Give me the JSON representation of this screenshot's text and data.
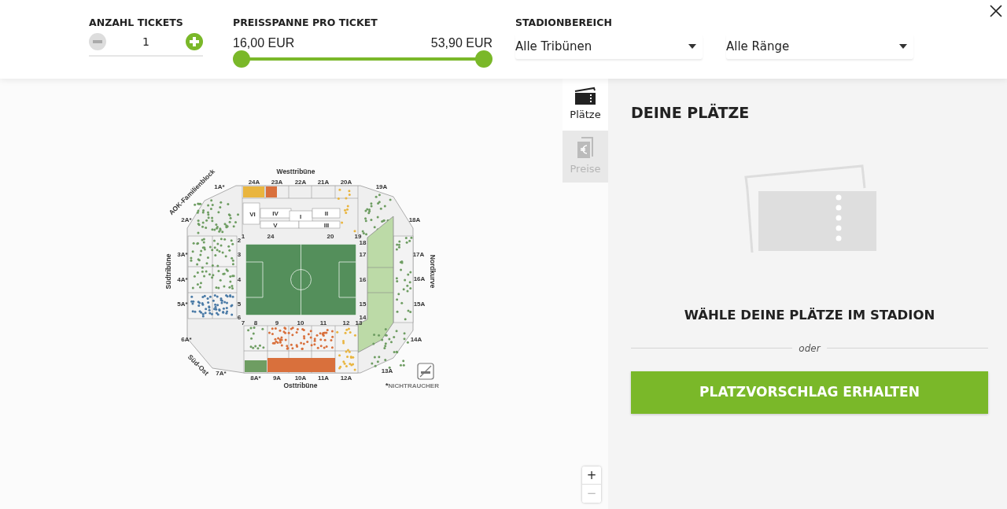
{
  "tickets": {
    "label": "ANZAHL TICKETS",
    "value": "1"
  },
  "price": {
    "label": "PREISSPANNE PRO TICKET",
    "min": "16,00 EUR",
    "max": "53,90 EUR",
    "thumbs": [
      {
        "level": 0
      },
      {
        "level": 1
      }
    ]
  },
  "area": {
    "label": "STADIONBEREICH",
    "selects": [
      "Alle Tribünen",
      "Alle Ränge"
    ]
  },
  "map": {
    "stands": [
      "Westtribüne",
      "Nordkurve",
      "Osttribüne",
      "Südtribüne",
      "AOK-Familienblock",
      "Süd-Ost"
    ],
    "outer_blocks": [
      "24A",
      "23A",
      "22A",
      "21A",
      "20A",
      "19A",
      "18A",
      "17A",
      "16A",
      "15A",
      "14A",
      "13A",
      "12A",
      "11A",
      "10A",
      "9A",
      "8A*",
      "7A*",
      "6A*",
      "5A*",
      "4A*",
      "3A*",
      "2A*",
      "1A*"
    ],
    "inner_blocks": [
      "1",
      "24",
      "20",
      "19",
      "18",
      "17",
      "16",
      "15",
      "14",
      "13",
      "12",
      "11",
      "10",
      "9",
      "8",
      "7",
      "6",
      "5",
      "4",
      "3",
      "2"
    ],
    "tiers": [
      "VI",
      "IV",
      "I",
      "II",
      "V",
      "III"
    ],
    "legend_mark": "*",
    "legend": "NICHTRAUCHER"
  },
  "zoom": [
    "+",
    "−"
  ],
  "tabs": [
    {
      "label": "Plätze",
      "selected": true
    },
    {
      "label": "Preise",
      "selected": false
    }
  ],
  "panel": {
    "title": "DEINE PLÄTZE",
    "prompt": "WÄHLE DEINE PLÄTZE IM STADION",
    "or": "oder",
    "button": "PLATZVORSCHLAG ERHALTEN"
  }
}
